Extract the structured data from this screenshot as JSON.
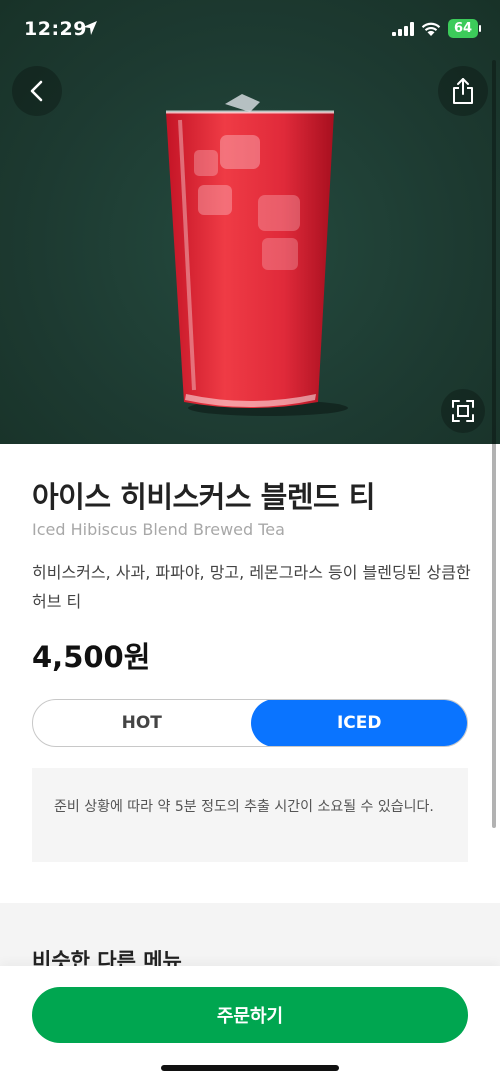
{
  "status_bar": {
    "time": "12:29",
    "battery": "64"
  },
  "product": {
    "name_ko": "아이스 히비스커스 블렌드 티",
    "name_en": "Iced Hibiscus Blend Brewed Tea",
    "description": "히비스커스, 사과, 파파야, 망고, 레몬그라스 등이 블렌딩된 상큼한 허브 티",
    "price": "4,500원"
  },
  "temperature_toggle": {
    "options": [
      "HOT",
      "ICED"
    ],
    "selected": "ICED"
  },
  "notice": "준비 상황에 따라 약 5분 정도의 추출 시간이 소요될 수 있습니다.",
  "similar_menu": {
    "title": "비슷한 다른 메뉴"
  },
  "order_button": {
    "label": "주문하기"
  },
  "colors": {
    "hero_bg": "#1f3d34",
    "accent_blue": "#0a74ff",
    "order_green": "#00a650",
    "drink_red": "#e0293a"
  },
  "icons": [
    "location-arrow-icon",
    "signal-icon",
    "wifi-icon",
    "battery-icon",
    "back-chevron-icon",
    "share-icon",
    "zoom-frame-icon"
  ]
}
